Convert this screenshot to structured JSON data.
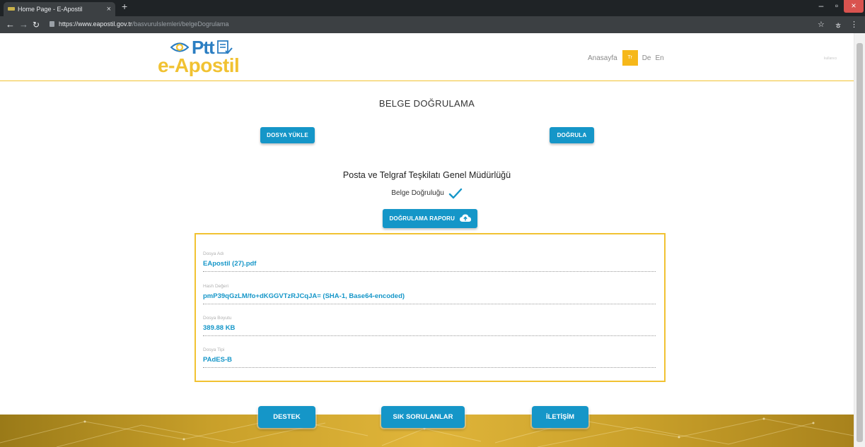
{
  "browser": {
    "tab_title": "Home Page - E-Apostil",
    "tab_close": "×",
    "new_tab": "+",
    "url_host": "https://www.eapostil.gov.tr",
    "url_path": "/basvuruIslemleri/belgeDogrulama",
    "controls": {
      "minimize": "–",
      "maximize": "▫",
      "close": "×"
    },
    "toolbar_icons": [
      "star-icon",
      "incognito-icon",
      "menu-icon"
    ]
  },
  "header": {
    "logo_ptt": "Ptt",
    "logo_name": "e-Apostil",
    "nav_home": "Anasayfa",
    "lang_tr": "Tr",
    "lang_de": "De",
    "lang_en": "En",
    "user_area": "kullanıcı"
  },
  "page": {
    "title": "BELGE DOĞRULAMA",
    "upload_button": "DOSYA YÜKLE",
    "verify_button": "DOĞRULA",
    "organization": "Posta ve Telgraf Teşkilatı Genel Müdürlüğü",
    "validity_label": "Belge Doğruluğu",
    "report_button": "DOĞRULAMA RAPORU"
  },
  "file_info": [
    {
      "label": "Dosya Adı",
      "value": "EApostil (27).pdf"
    },
    {
      "label": "Hash Değeri",
      "value": "pmP39qGzLM/fo+dKGGVTzRJCqJA= (SHA-1, Base64-encoded)"
    },
    {
      "label": "Dosya Boyutu",
      "value": "389.88 KB"
    },
    {
      "label": "Dosya Tipi",
      "value": "PAdES-B"
    }
  ],
  "footer": {
    "support": "DESTEK",
    "faq": "SIK SORULANLAR",
    "contact": "İLETİŞİM"
  },
  "colors": {
    "accent_blue": "#1596c8",
    "accent_yellow": "#f1c232",
    "logo_blue": "#2b7ec2"
  }
}
